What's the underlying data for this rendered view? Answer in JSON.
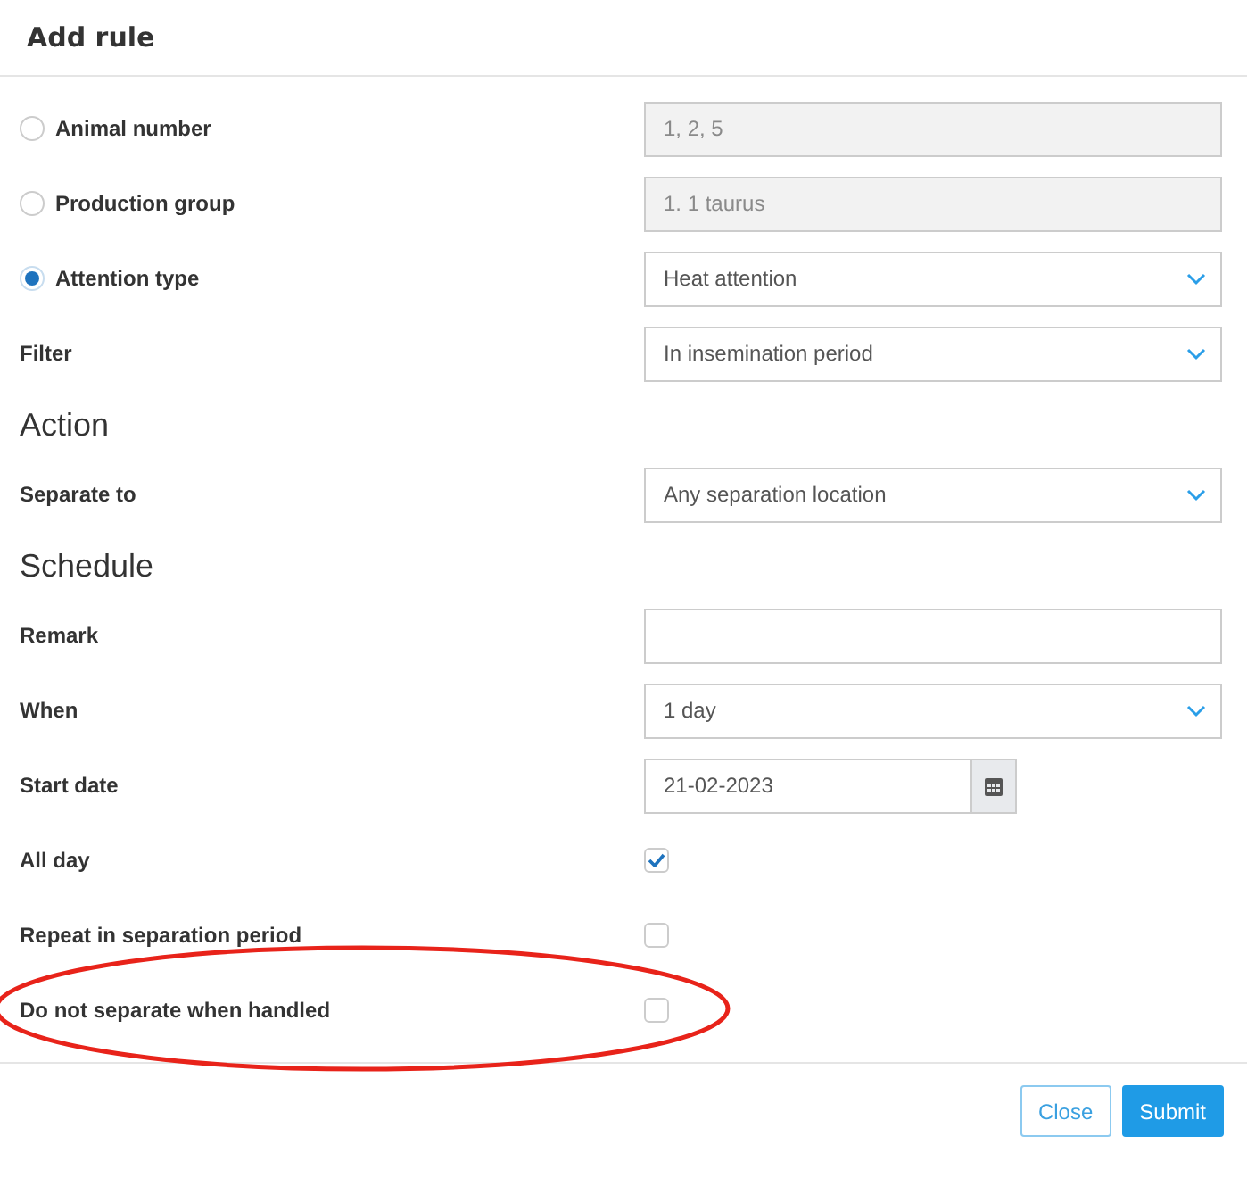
{
  "dialog": {
    "title": "Add rule"
  },
  "rows": [
    {
      "kind": "field",
      "label": "Animal number",
      "radio": {
        "selected": false
      },
      "control": {
        "kind": "input",
        "value": "1, 2, 5",
        "disabled": true
      }
    },
    {
      "kind": "field",
      "label": "Production group",
      "radio": {
        "selected": false
      },
      "control": {
        "kind": "input",
        "value": "1. 1 taurus",
        "disabled": true
      }
    },
    {
      "kind": "field",
      "label": "Attention type",
      "radio": {
        "selected": true
      },
      "control": {
        "kind": "select",
        "value": "Heat attention"
      }
    },
    {
      "kind": "field",
      "label": "Filter",
      "control": {
        "kind": "select",
        "value": "In insemination period"
      }
    },
    {
      "kind": "heading",
      "label": "Action"
    },
    {
      "kind": "field",
      "label": "Separate to",
      "control": {
        "kind": "select",
        "value": "Any separation location"
      }
    },
    {
      "kind": "heading",
      "label": "Schedule"
    },
    {
      "kind": "field",
      "label": "Remark",
      "control": {
        "kind": "input",
        "disabled": false
      }
    },
    {
      "kind": "field",
      "label": "When",
      "control": {
        "kind": "select",
        "value": "1 day"
      }
    },
    {
      "kind": "field",
      "label": "Start date",
      "control": {
        "kind": "date",
        "value": "21-02-2023"
      }
    },
    {
      "kind": "field",
      "label": "All day",
      "control": {
        "kind": "checkbox",
        "checked": true
      }
    },
    {
      "kind": "field",
      "label": "Repeat in separation period",
      "control": {
        "kind": "checkbox",
        "checked": false
      }
    },
    {
      "kind": "field",
      "label": "Do not separate when handled",
      "control": {
        "kind": "checkbox",
        "checked": false
      }
    }
  ],
  "annotation": {
    "kind": "ellipse",
    "color": "#e8231a"
  },
  "buttons": [
    {
      "label": "Close",
      "kind": "secondary"
    },
    {
      "label": "Submit",
      "kind": "primary"
    }
  ]
}
